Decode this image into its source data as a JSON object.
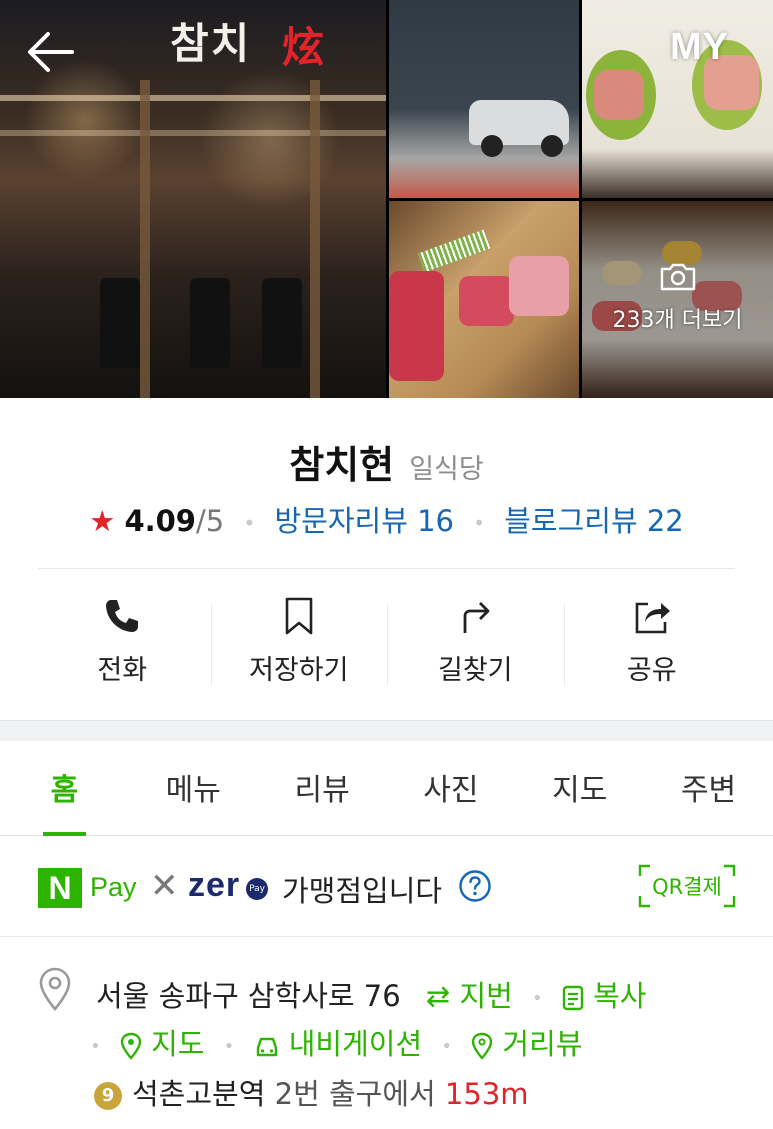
{
  "header": {
    "my_label": "MY",
    "back_icon": "arrow-left-icon"
  },
  "gallery": {
    "main_sign": "참치",
    "main_sign_hanja": "炫",
    "more_photos_label": "233개 더보기"
  },
  "place": {
    "name": "참치현",
    "category": "일식당",
    "rating_star": "★",
    "rating": "4.09",
    "rating_max": "/5",
    "visitor_reviews": "방문자리뷰 16",
    "blog_reviews": "블로그리뷰 22"
  },
  "actions": [
    {
      "label": "전화",
      "icon": "phone-icon"
    },
    {
      "label": "저장하기",
      "icon": "bookmark-icon"
    },
    {
      "label": "길찾기",
      "icon": "directions-icon"
    },
    {
      "label": "공유",
      "icon": "share-icon"
    }
  ],
  "tabs": [
    {
      "label": "홈",
      "active": true
    },
    {
      "label": "메뉴"
    },
    {
      "label": "리뷰"
    },
    {
      "label": "사진"
    },
    {
      "label": "지도"
    },
    {
      "label": "주변"
    }
  ],
  "pay": {
    "npay_letter": "N",
    "pay_label": "Pay",
    "times": "✕",
    "zero_label": "zer",
    "zero_pay": "Pay",
    "merchant_text": "가맹점입니다",
    "qr_label": "QR결제"
  },
  "address": {
    "street": "서울 송파구 삼학사로 76",
    "jibun_label": "지번",
    "copy_label": "복사",
    "map_label": "지도",
    "navigation_label": "내비게이션",
    "street_view_label": "거리뷰",
    "subway_line": "9",
    "station": "석촌고분역",
    "exit_text": "2번 출구에서",
    "distance": "153m"
  },
  "colors": {
    "accent_green": "#2db400",
    "link_blue": "#1667b2",
    "star_red": "#e2242a",
    "line9_gold": "#c9a53a"
  }
}
